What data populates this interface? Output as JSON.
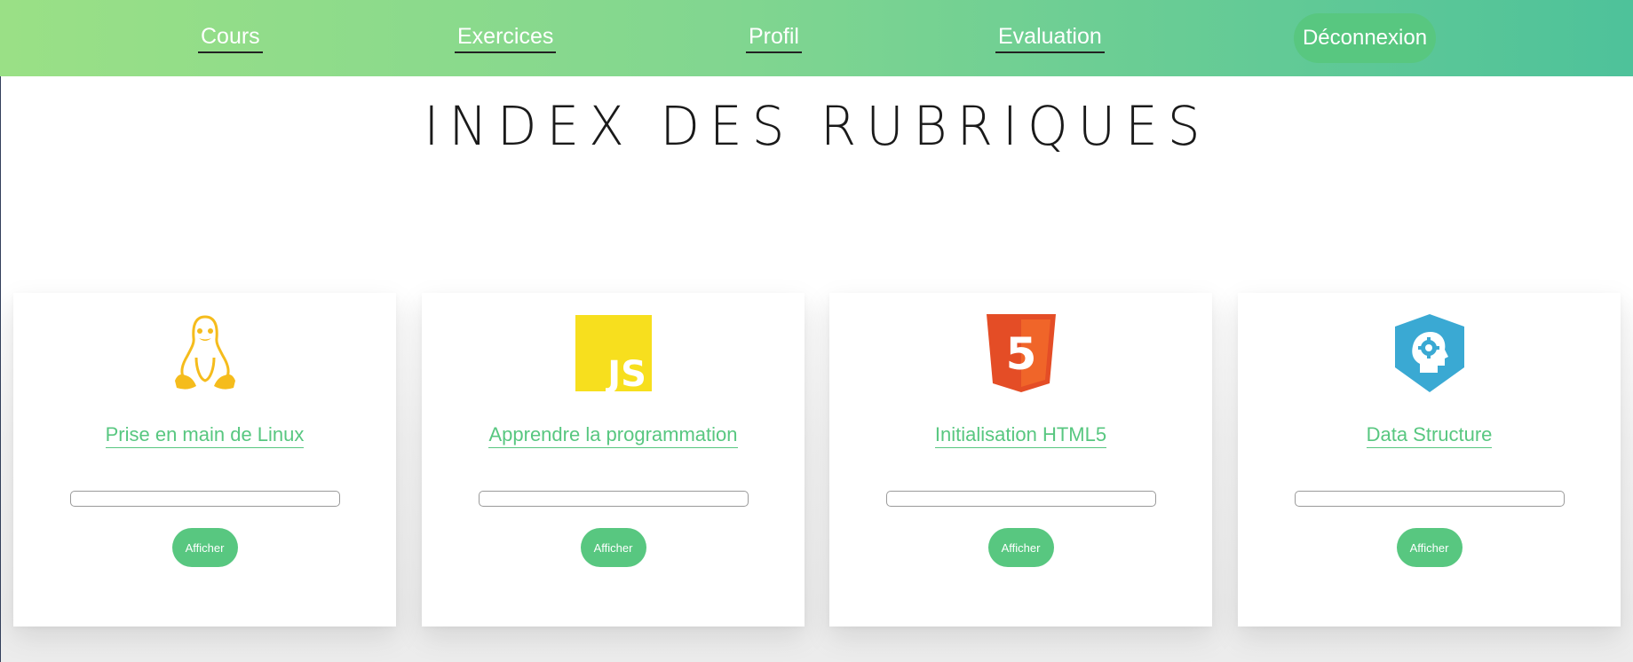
{
  "nav": {
    "links": [
      {
        "label": "Cours"
      },
      {
        "label": "Exercices"
      },
      {
        "label": "Profil"
      },
      {
        "label": "Evaluation"
      }
    ],
    "logout_label": "Déconnexion",
    "gradient": [
      "#9ae086",
      "#4ec29a"
    ]
  },
  "page": {
    "title": "INDEX DES RUBRIQUES"
  },
  "colors": {
    "accent": "#58c780",
    "linux": "#f5bc1c",
    "javascript": "#f7df1e",
    "html5": "#e44d26",
    "data_structure": "#3aa9d3"
  },
  "cards": [
    {
      "icon": "linux-icon",
      "title": "Prise en main de Linux",
      "progress": 0,
      "button": "Afficher"
    },
    {
      "icon": "javascript-icon",
      "title": "Apprendre la programmation",
      "progress": 0,
      "button": "Afficher",
      "icon_text": "JS"
    },
    {
      "icon": "html5-icon",
      "title": "Initialisation HTML5",
      "progress": 0,
      "button": "Afficher",
      "icon_text": "5"
    },
    {
      "icon": "data-structure-icon",
      "title": "Data Structure",
      "progress": 0,
      "button": "Afficher"
    }
  ]
}
